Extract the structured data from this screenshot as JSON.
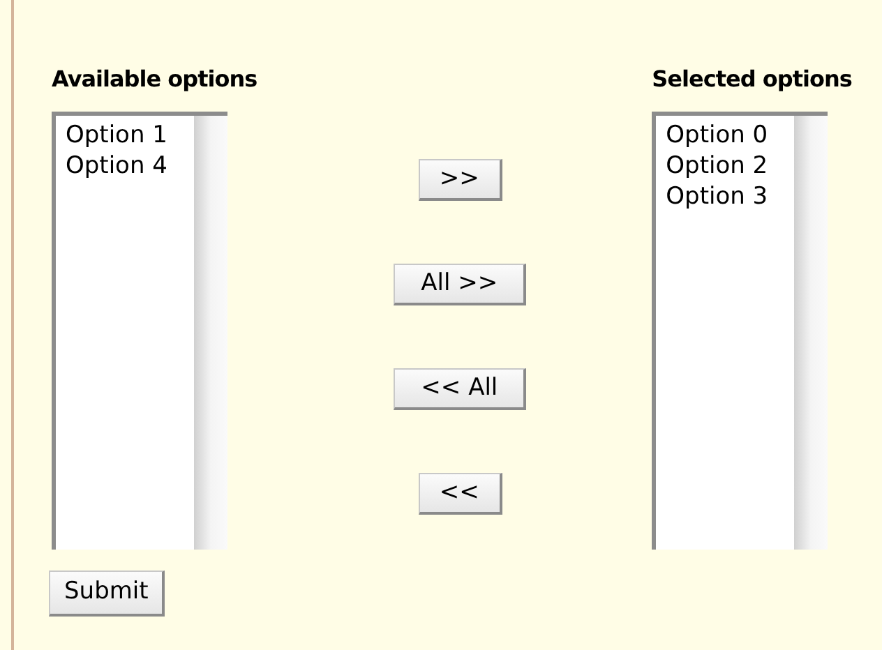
{
  "available": {
    "label": "Available options",
    "items": [
      "Option 1",
      "Option 4"
    ]
  },
  "buttons": [
    ">>",
    "All >>",
    "<< All",
    "<<"
  ],
  "selected": {
    "label": "Selected options",
    "items": [
      "Option 0",
      "Option 2",
      "Option 3"
    ]
  },
  "submit": "Submit"
}
